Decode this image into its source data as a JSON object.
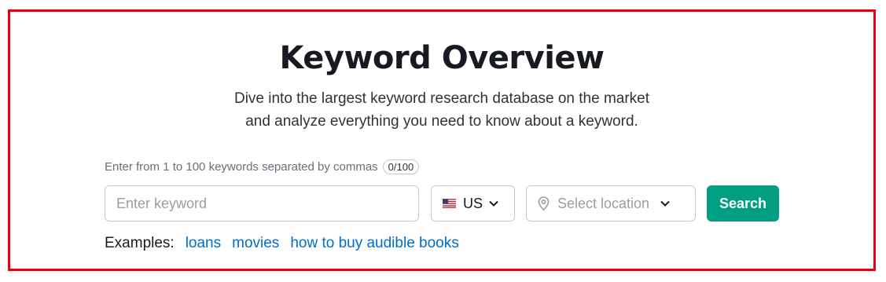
{
  "page": {
    "title": "Keyword Overview",
    "subtitle_line1": "Dive into the largest keyword research database on the market",
    "subtitle_line2": "and analyze everything you need to know about a keyword."
  },
  "form": {
    "hint": "Enter from 1 to 100 keywords separated by commas",
    "counter": "0/100",
    "keyword_placeholder": "Enter keyword",
    "keyword_value": "",
    "database": "US",
    "database_flag_icon": "us-flag-icon",
    "location_placeholder": "Select location",
    "location_icon": "location-pin-icon",
    "search_label": "Search"
  },
  "examples": {
    "label": "Examples:",
    "links": [
      "loans",
      "movies",
      "how to buy audible books"
    ]
  },
  "colors": {
    "frame_border": "#e8000b",
    "search_button": "#009f81",
    "link": "#006dca",
    "title": "#171a22"
  }
}
